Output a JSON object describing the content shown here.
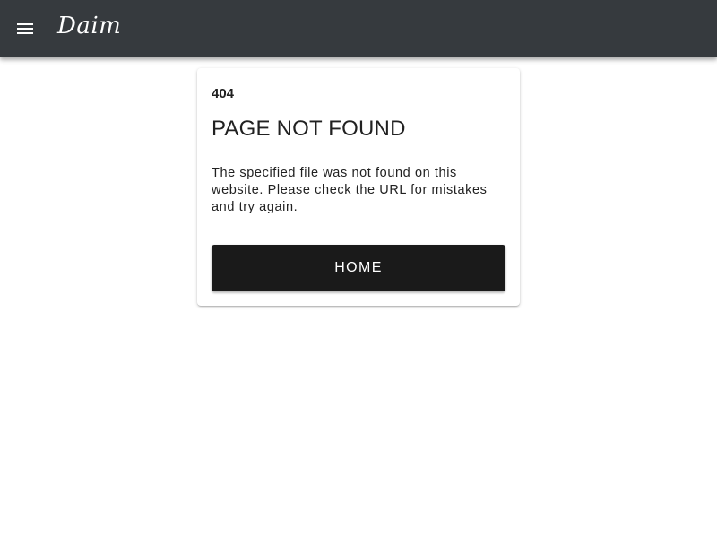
{
  "app_bar": {
    "menu_icon": "menu-icon",
    "brand": "Daim",
    "background_color": "#363a3e"
  },
  "error_card": {
    "code": "404",
    "title": "PAGE NOT FOUND",
    "message": "The specified file was not found on this website. Please check the URL for mistakes and try again.",
    "home_button_label": "HOME",
    "button_color": "#1a1a1a"
  }
}
